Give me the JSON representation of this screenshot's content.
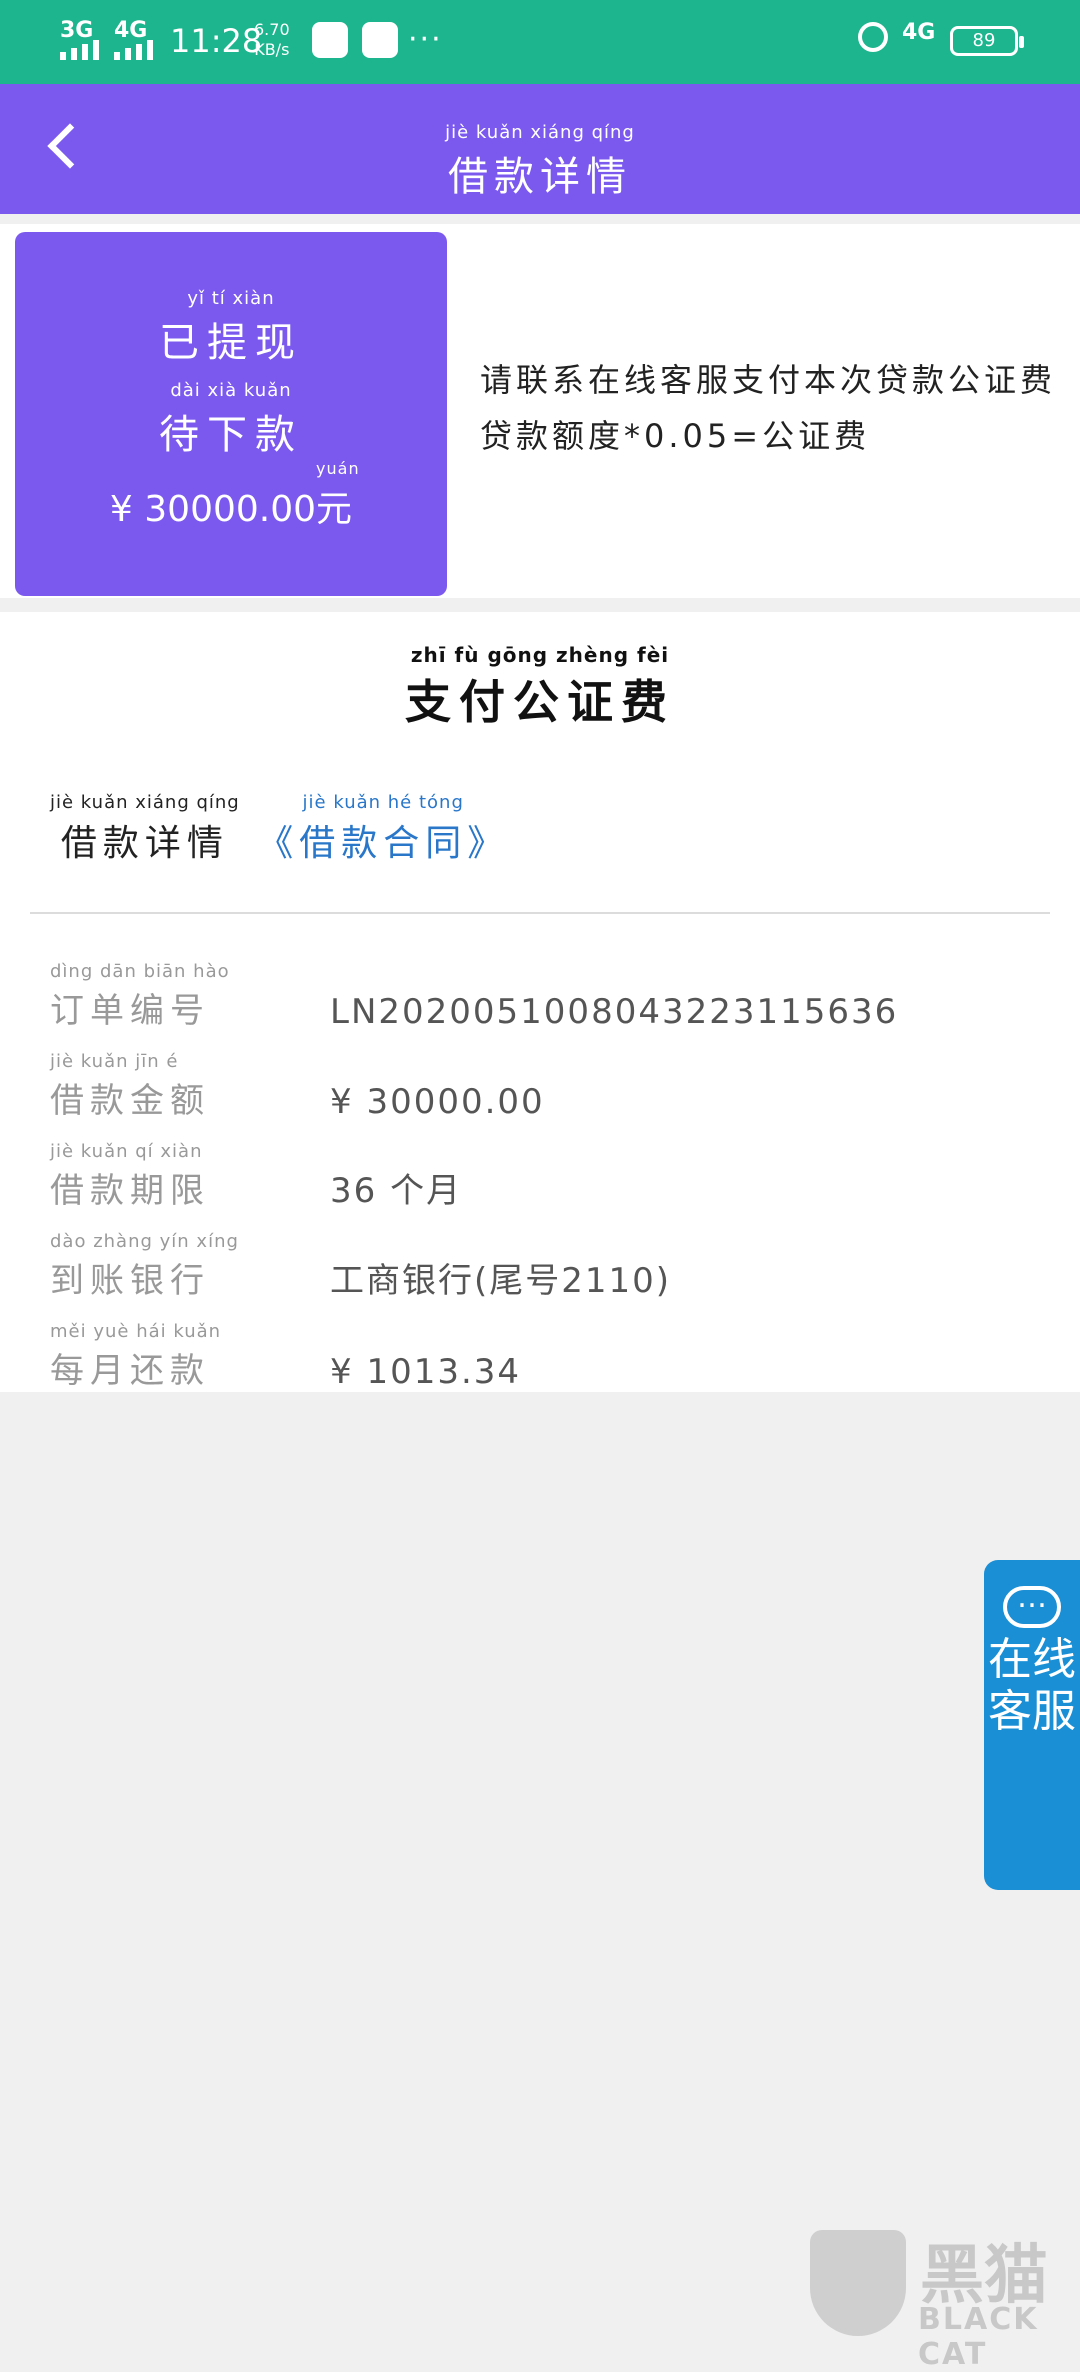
{
  "status_bar": {
    "signal1": "3G",
    "signal2": "4G",
    "time": "11:28",
    "speed_value": "6.70",
    "speed_unit": "KB/s",
    "dots": "···",
    "network": "4G",
    "battery": "89"
  },
  "header": {
    "title_pinyin": "jiè kuǎn xiáng qíng",
    "title": "借款详情"
  },
  "status_card": {
    "line1_pinyin": "yǐ tí xiàn",
    "line1": "已提现",
    "line2_pinyin": "dài xià kuǎn",
    "line2": "待下款",
    "amount": "¥ 30000.00",
    "unit_pinyin": "yuán",
    "unit": "元"
  },
  "notice": {
    "text": "请联系在线客服支付本次贷款公证费 贷款额度*0.05=公证费"
  },
  "section": {
    "title_pinyin": "zhī fù gōng zhèng fèi",
    "title": "支付公证费",
    "detail_pinyin": "jiè kuǎn xiáng qíng",
    "detail_label": "借款详情",
    "contract_pinyin": "jiè kuǎn hé tóng",
    "contract_link": "《借款合同》"
  },
  "details": [
    {
      "label_pinyin": "dìng dān biān hào",
      "label": "订单编号",
      "value": "LN2020051008043223115636"
    },
    {
      "label_pinyin": "jiè kuǎn jīn é",
      "label": "借款金额",
      "value": "¥ 30000.00"
    },
    {
      "label_pinyin": "jiè kuǎn qí xiàn",
      "label": "借款期限",
      "value": "36 个月"
    },
    {
      "label_pinyin": "dào zhàng yín xíng",
      "label": "到账银行",
      "value": "工商银行(尾号2110)"
    },
    {
      "label_pinyin": "měi yuè hái kuǎn",
      "label": "每月还款",
      "value": "¥ 1013.34"
    }
  ],
  "service_button": {
    "label_line1": "在线",
    "label_line2": "客服"
  },
  "watermark": {
    "cn": "黑猫",
    "en": "BLACK CAT"
  },
  "colors": {
    "status_bar": "#1db58d",
    "accent_purple": "#7b59ef",
    "link_blue": "#2a77c9",
    "service_blue": "#1a8fd6"
  }
}
